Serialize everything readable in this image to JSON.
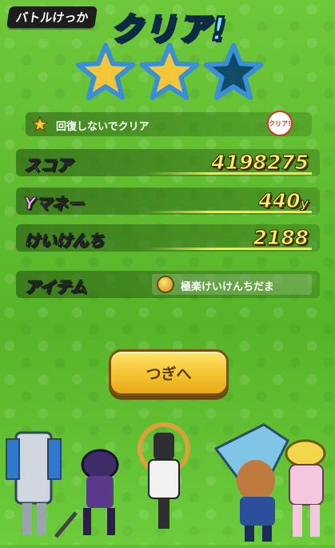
{
  "header": {
    "battle_result_label": "バトルけっか",
    "title": "クリア!"
  },
  "stars": {
    "earned": 2,
    "total": 3
  },
  "mission": {
    "text": "回復しないでクリア",
    "badge": "クリア!"
  },
  "stats": {
    "score_label": "スコア",
    "score_value": "4198275",
    "ymoney_label": "Yマネー",
    "ymoney_value": "440",
    "ymoney_unit": "y",
    "exp_label": "けいけんち",
    "exp_value": "2188"
  },
  "item": {
    "label": "アイテム",
    "name": "極楽けいけんちだま"
  },
  "buttons": {
    "next_label": "つぎへ"
  },
  "colors": {
    "background": "#62bf2f",
    "accent": "#ffef5e",
    "title": "#7fe3ff",
    "button": "#f5c431"
  }
}
